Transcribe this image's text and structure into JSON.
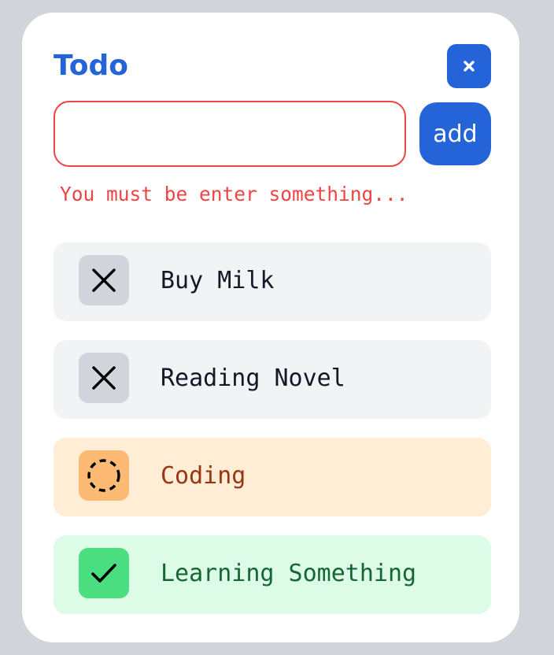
{
  "header": {
    "title": "Todo",
    "close_label": "×"
  },
  "form": {
    "input_value": "",
    "input_placeholder": "",
    "add_label": "add",
    "error_message": "You must be enter something..."
  },
  "todos": [
    {
      "label": "Buy Milk",
      "status": "cancelled",
      "icon": "x-icon",
      "bg": "#f2f3f5",
      "box_bg": "#d1d5db",
      "text_color": "#111827"
    },
    {
      "label": "Reading Novel",
      "status": "cancelled",
      "icon": "x-icon",
      "bg": "#f2f3f5",
      "box_bg": "#d1d5db",
      "text_color": "#111827"
    },
    {
      "label": "Coding",
      "status": "in-progress",
      "icon": "dashed-circle-icon",
      "bg": "#ffedd5",
      "box_bg": "#fdba74",
      "text_color": "#9a3412"
    },
    {
      "label": "Learning Something",
      "status": "done",
      "icon": "check-icon",
      "bg": "#dcfce7",
      "box_bg": "#4ade80",
      "text_color": "#166534"
    }
  ],
  "colors": {
    "accent": "#2563d8",
    "error": "#ef4444",
    "page_background": "#d1d5db",
    "card_background": "#ffffff"
  }
}
